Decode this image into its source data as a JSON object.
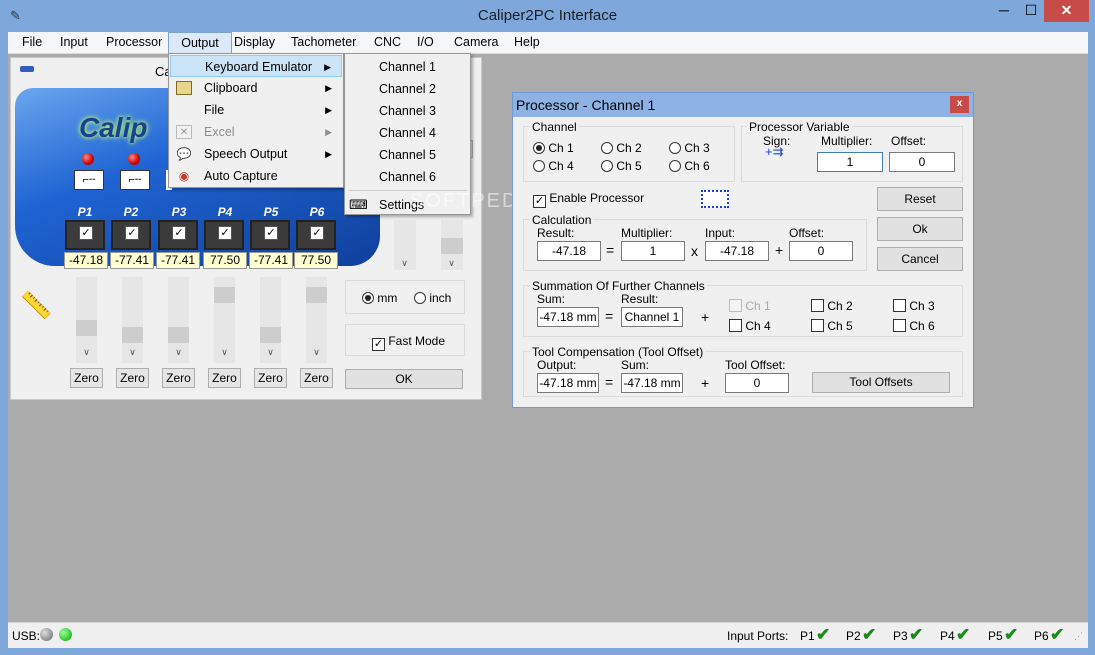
{
  "window": {
    "title": "Caliper2PC Interface",
    "minimize": "─",
    "maximize": "☐",
    "close": "✕"
  },
  "menubar": [
    "File",
    "Input",
    "Processor",
    "Output",
    "Display",
    "Tachometer",
    "CNC",
    "I/O",
    "Camera",
    "Help"
  ],
  "output_menu": {
    "items": [
      {
        "label": "Keyboard Emulator",
        "icon": "keyboard-emulator-icon",
        "submenu": true,
        "highlighted": true,
        "enabled": true
      },
      {
        "label": "Clipboard",
        "icon": "clipboard-icon",
        "submenu": true,
        "enabled": true
      },
      {
        "label": "File",
        "icon": "",
        "submenu": true,
        "enabled": true
      },
      {
        "label": "Excel",
        "icon": "excel-icon",
        "submenu": true,
        "enabled": false
      },
      {
        "label": "Speech Output",
        "icon": "speech-icon",
        "submenu": true,
        "enabled": true
      },
      {
        "label": "Auto Capture",
        "icon": "auto-capture-icon",
        "submenu": false,
        "enabled": true
      }
    ]
  },
  "keyboard_submenu": {
    "items": [
      "Channel 1",
      "Channel 2",
      "Channel 3",
      "Channel 4",
      "Channel 5",
      "Channel 6"
    ],
    "settings": "Settings"
  },
  "main": {
    "title_partial": "Ca",
    "device_logo": "Calip",
    "ports": [
      {
        "label": "P1",
        "value": "-47.18",
        "checked": true
      },
      {
        "label": "P2",
        "value": "-77.41",
        "checked": true
      },
      {
        "label": "P3",
        "value": "-77.41",
        "checked": true
      },
      {
        "label": "P4",
        "value": "77.50",
        "checked": true
      },
      {
        "label": "P5",
        "value": "-77.41",
        "checked": true
      },
      {
        "label": "P6",
        "value": "77.50",
        "checked": true
      }
    ],
    "zero_label": "Zero",
    "units": {
      "mm": "mm",
      "inch": "inch",
      "selected": "mm"
    },
    "fast_mode": {
      "label": "Fast Mode",
      "checked": true
    },
    "ok": "OK"
  },
  "processor": {
    "title": "Processor - Channel 1",
    "close": "x",
    "channel": {
      "caption": "Channel",
      "options": [
        "Ch 1",
        "Ch 2",
        "Ch 3",
        "Ch 4",
        "Ch 5",
        "Ch 6"
      ],
      "selected": "Ch 1"
    },
    "variable": {
      "caption": "Processor Variable",
      "sign_label": "Sign:",
      "multiplier_label": "Multiplier:",
      "multiplier": "1",
      "offset_label": "Offset:",
      "offset": "0"
    },
    "enable": {
      "label": "Enable Processor",
      "checked": true
    },
    "calc": {
      "caption": "Calculation",
      "result_label": "Result:",
      "result": "-47.18",
      "eq": "=",
      "mult_label": "Multiplier:",
      "mult": "1",
      "x": "x",
      "input_label": "Input:",
      "input": "-47.18",
      "plus": "+",
      "offset_label": "Offset:",
      "offset": "0"
    },
    "sum": {
      "caption": "Summation Of Further Channels",
      "sum_label": "Sum:",
      "sum": "-47.18 mm",
      "eq": "=",
      "result_label": "Result:",
      "result": "Channel 1",
      "plus": "+",
      "channels": [
        {
          "label": "Ch 1",
          "disabled": true
        },
        {
          "label": "Ch 2"
        },
        {
          "label": "Ch 3"
        },
        {
          "label": "Ch 4"
        },
        {
          "label": "Ch 5"
        },
        {
          "label": "Ch 6"
        }
      ]
    },
    "tool": {
      "caption": "Tool Compensation (Tool Offset)",
      "output_label": "Output:",
      "output": "-47.18 mm",
      "eq": "=",
      "sum_label": "Sum:",
      "sum": "-47.18 mm",
      "plus": "+",
      "tool_label": "Tool Offset:",
      "tool": "0",
      "button": "Tool Offsets"
    },
    "buttons": {
      "reset": "Reset",
      "ok": "Ok",
      "cancel": "Cancel"
    }
  },
  "status": {
    "usb": "USB:",
    "input_ports": "Input Ports:",
    "ports": [
      "P1",
      "P2",
      "P3",
      "P4",
      "P5",
      "P6"
    ]
  },
  "watermark": "SOFTPEDIA"
}
